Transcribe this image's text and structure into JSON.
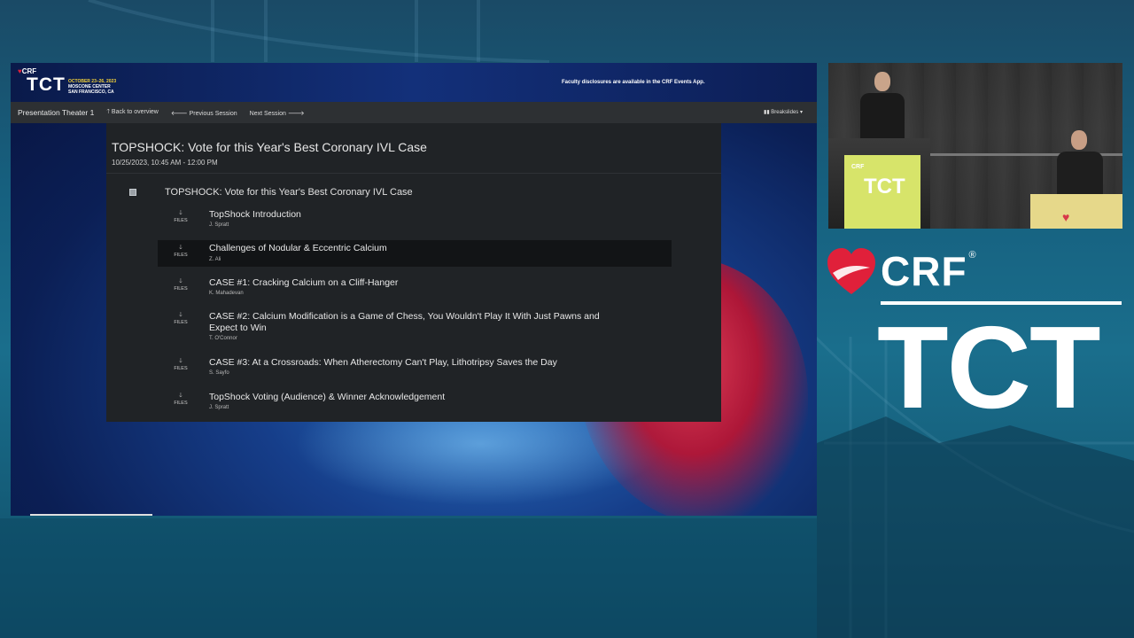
{
  "banner": {
    "crf_label": "CRF",
    "tct_label": "TCT",
    "event_dates": "OCTOBER 23–26, 2023",
    "event_venue": "MOSCONE CENTER",
    "event_city": "SAN FRANCISCO, CA",
    "disclosure": "Faculty disclosures are available in the CRF Events App."
  },
  "navbar": {
    "brand": "Presentation Theater 1",
    "back": "Back to overview",
    "prev": "Previous Session",
    "next": "Next Session",
    "right": "Breakslides"
  },
  "session": {
    "title": "TOPSHOCK: Vote for this Year's Best Coronary IVL Case",
    "datetime": "10/25/2023, 10:45 AM - 12:00 PM",
    "subtitle": "TOPSHOCK: Vote for this Year's Best Coronary IVL Case",
    "files_label": "FILES",
    "talks": [
      {
        "title": "TopShock Introduction",
        "speaker": "J. Spratt"
      },
      {
        "title": "Challenges of Nodular & Eccentric Calcium",
        "speaker": "Z. Ali"
      },
      {
        "title": "CASE #1: Cracking Calcium on a Cliff-Hanger",
        "speaker": "K. Mahadevan"
      },
      {
        "title": "CASE #2: Calcium Modification is a Game of Chess, You Wouldn't Play It With Just Pawns and Expect to Win",
        "speaker": "T. O'Connor"
      },
      {
        "title": "CASE #3: At a Crossroads: When Atherectomy Can't Play, Lithotripsy Saves the Day",
        "speaker": "S. Sayfo"
      },
      {
        "title": "TopShock Voting (Audience) & Winner Acknowledgement",
        "speaker": "J. Spratt"
      }
    ]
  },
  "branding": {
    "crf": "CRF",
    "registered": "®",
    "tct": "TCT"
  },
  "camera": {
    "podium_crf": "CRF",
    "podium_tct": "TCT"
  },
  "colors": {
    "accent_red": "#e0203a",
    "date_yellow": "#f3d23a",
    "panel_bg": "#202326",
    "navbar_bg": "#2d3033"
  }
}
